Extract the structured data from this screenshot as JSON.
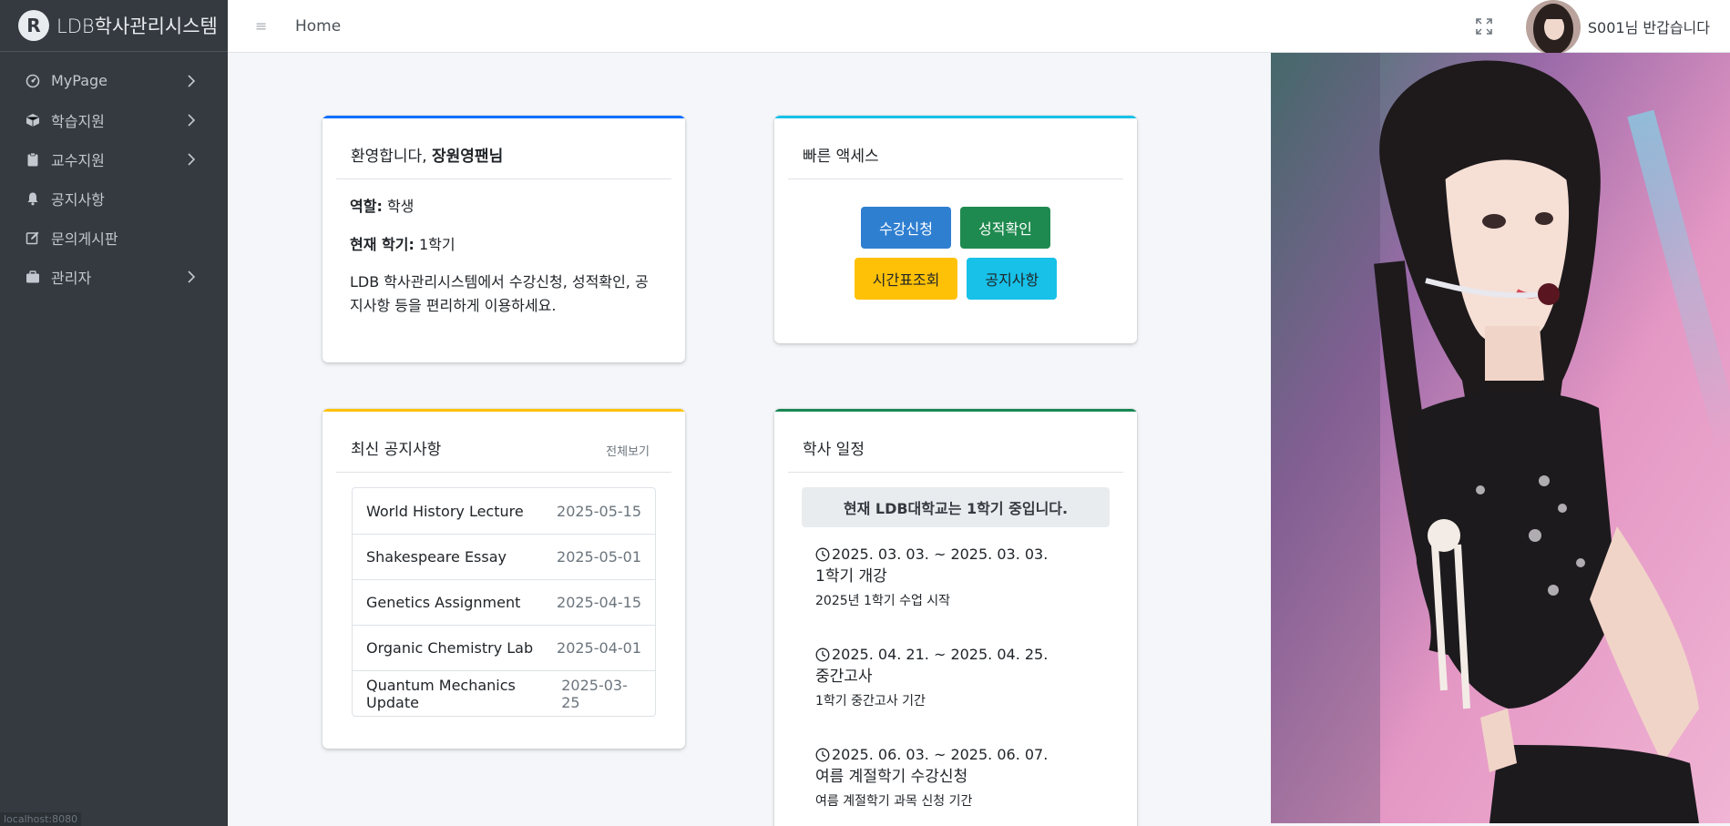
{
  "brand": {
    "title": "LDB학사관리시스템",
    "logo_letter": "R"
  },
  "sidebar": {
    "items": [
      {
        "label": "MyPage",
        "icon": "dashboard-icon",
        "has_children": true
      },
      {
        "label": "학습지원",
        "icon": "cube-icon",
        "has_children": true
      },
      {
        "label": "교수지원",
        "icon": "clipboard-icon",
        "has_children": true
      },
      {
        "label": "공지사항",
        "icon": "bell-icon",
        "has_children": false
      },
      {
        "label": "문의게시판",
        "icon": "edit-icon",
        "has_children": false
      },
      {
        "label": "관리자",
        "icon": "briefcase-icon",
        "has_children": true
      }
    ],
    "status_url": "localhost:8080"
  },
  "header": {
    "home_label": "Home",
    "greeting": "S001님 반갑습니다"
  },
  "welcome": {
    "prefix": "환영합니다,",
    "name": "장원영팬님",
    "role_label": "역할:",
    "role_value": "학생",
    "semester_label": "현재 학기:",
    "semester_value": "1학기",
    "description": "LDB 학사관리시스템에서 수강신청, 성적확인, 공지사항 등을 편리하게 이용하세요."
  },
  "quick_access": {
    "title": "빠른 액세스",
    "buttons": [
      {
        "label": "수강신청",
        "color": "#2f7fd1"
      },
      {
        "label": "성적확인",
        "color": "#1f8a4f"
      },
      {
        "label": "시간표조회",
        "color": "#ffc107"
      },
      {
        "label": "공지사항",
        "color": "#17c1e8"
      }
    ]
  },
  "notices": {
    "title": "최신 공지사항",
    "view_all": "전체보기",
    "items": [
      {
        "title": "World History Lecture",
        "date": "2025-05-15"
      },
      {
        "title": "Shakespeare Essay",
        "date": "2025-05-01"
      },
      {
        "title": "Genetics Assignment",
        "date": "2025-04-15"
      },
      {
        "title": "Organic Chemistry Lab",
        "date": "2025-04-01"
      },
      {
        "title": "Quantum Mechanics Update",
        "date": "2025-03-25"
      }
    ]
  },
  "schedule": {
    "title": "학사 일정",
    "banner": "현재 LDB대학교는 1학기 중입니다.",
    "events": [
      {
        "date": "2025. 03. 03. ~ 2025. 03. 03.",
        "title": "1학기 개강",
        "desc": "2025년 1학기 수업 시작"
      },
      {
        "date": "2025. 04. 21. ~ 2025. 04. 25.",
        "title": "중간고사",
        "desc": "1학기 중간고사 기간"
      },
      {
        "date": "2025. 06. 03. ~ 2025. 06. 07.",
        "title": "여름 계절학기 수강신청",
        "desc": "여름 계절학기 과목 신청 기간"
      }
    ]
  },
  "colors": {
    "sidebar_bg": "#343a40",
    "welcome_accent": "#0d6efd",
    "quick_accent": "#17c1e8",
    "notice_accent": "#ffc107",
    "schedule_accent": "#198754"
  }
}
